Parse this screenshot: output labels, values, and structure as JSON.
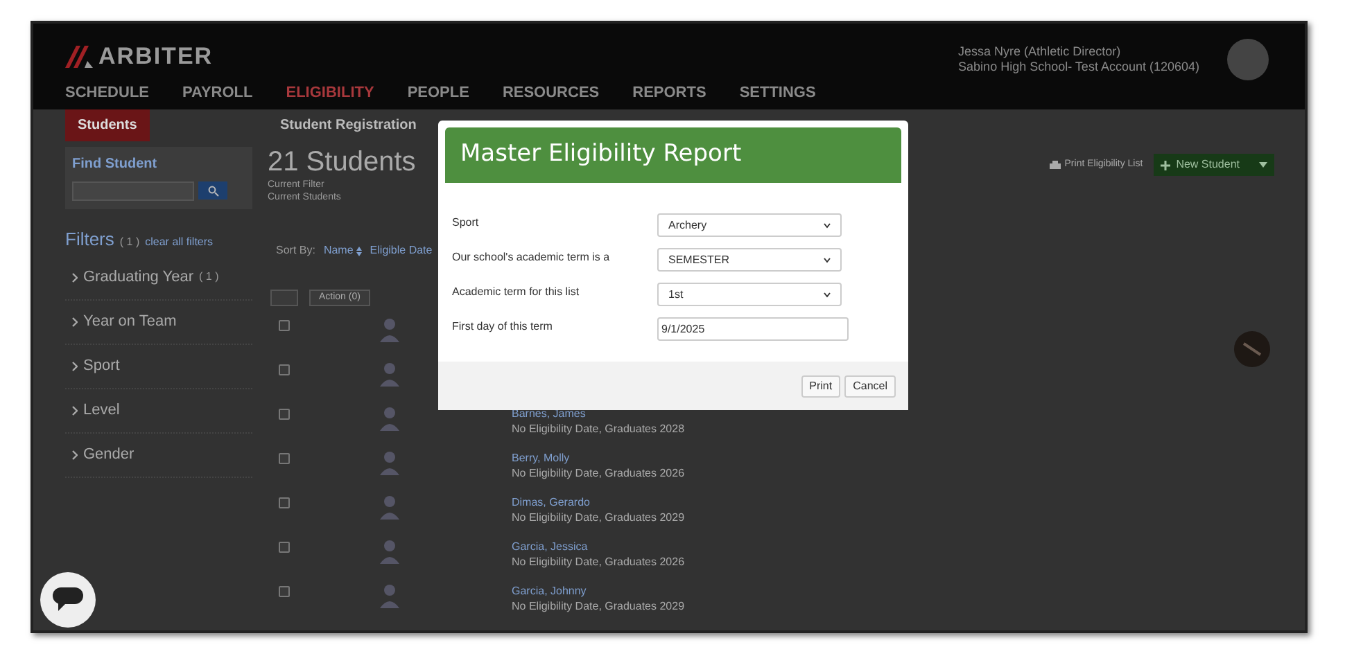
{
  "header": {
    "logo": "ARBITER",
    "nav": [
      {
        "label": "SCHEDULE",
        "selected": false
      },
      {
        "label": "PAYROLL",
        "selected": false
      },
      {
        "label": "ELIGIBILITY",
        "selected": true
      },
      {
        "label": "PEOPLE",
        "selected": false
      },
      {
        "label": "RESOURCES",
        "selected": false
      },
      {
        "label": "REPORTS",
        "selected": false
      },
      {
        "label": "SETTINGS",
        "selected": false
      }
    ],
    "user": {
      "name": "Jessa Nyre (Athletic Director)",
      "account": "Sabino High School- Test Account (120604)"
    }
  },
  "subnav": [
    {
      "label": "Students",
      "selected": true
    },
    {
      "label": "Student Registration",
      "selected": false
    }
  ],
  "sidebar": {
    "find_student": {
      "title": "Find Student"
    },
    "filters_title": "Filters",
    "filters_count": "( 1 )",
    "clear_link": "clear all filters",
    "filters": [
      {
        "label": "Graduating Year",
        "count": "( 1 )"
      },
      {
        "label": "Year on Team"
      },
      {
        "label": "Sport"
      },
      {
        "label": "Level"
      },
      {
        "label": "Gender"
      }
    ]
  },
  "main": {
    "title": "21 Students",
    "filter_label": "Current Filter",
    "filter_value": "Current Students",
    "print_link": "Print Eligibility List",
    "new_button": "New Student",
    "sort_label": "Sort By:",
    "sort_options": [
      "Name",
      "Eligible Date"
    ],
    "action_label": "Action (0)",
    "rows": [
      {
        "checked": false
      },
      {
        "checked": false
      },
      {
        "checked": false,
        "name": "Barnes, James",
        "detail": "No Eligibility Date, Graduates 2028"
      },
      {
        "checked": false,
        "name": "Berry, Molly",
        "detail": "No Eligibility Date, Graduates 2026"
      },
      {
        "checked": false,
        "name": "Dimas, Gerardo",
        "detail": "No Eligibility Date, Graduates 2029"
      },
      {
        "checked": false,
        "name": "Garcia, Jessica",
        "detail": "No Eligibility Date, Graduates 2026"
      },
      {
        "checked": false,
        "name": "Garcia, Johnny",
        "detail": "No Eligibility Date, Graduates 2029"
      }
    ]
  },
  "modal": {
    "title": "Master Eligibility Report",
    "fields": [
      {
        "kind": "select",
        "label": "Sport",
        "value": "Archery"
      },
      {
        "kind": "select",
        "label": "Our school's academic term is a",
        "value": "SEMESTER"
      },
      {
        "kind": "select",
        "label": "Academic term for this list",
        "value": "1st"
      },
      {
        "kind": "text",
        "label": "First day of this term",
        "value": "9/1/2025"
      }
    ],
    "buttons": [
      "Print",
      "Cancel"
    ]
  }
}
